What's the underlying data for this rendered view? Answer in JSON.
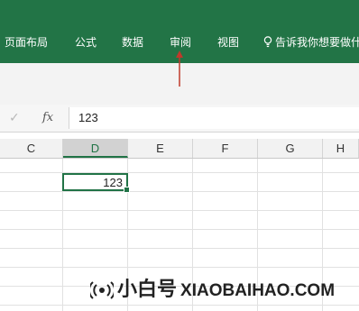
{
  "ribbon": {
    "color": "#227446",
    "tabs": [
      {
        "label": "页面布局"
      },
      {
        "label": "公式"
      },
      {
        "label": "数据"
      },
      {
        "label": "审阅"
      },
      {
        "label": "视图"
      }
    ],
    "tell_me": "告诉我你想要做什"
  },
  "formula_bar": {
    "fx_label": "fx",
    "value": "123"
  },
  "columns": [
    "C",
    "D",
    "E",
    "F",
    "G",
    "H"
  ],
  "selected_column": "D",
  "active_cell": {
    "value": "123"
  },
  "watermark": {
    "name": "小白号",
    "site": "XIAOBAIHAO.COM"
  },
  "annotation_color": "#c0392b",
  "accent_color": "#217346"
}
